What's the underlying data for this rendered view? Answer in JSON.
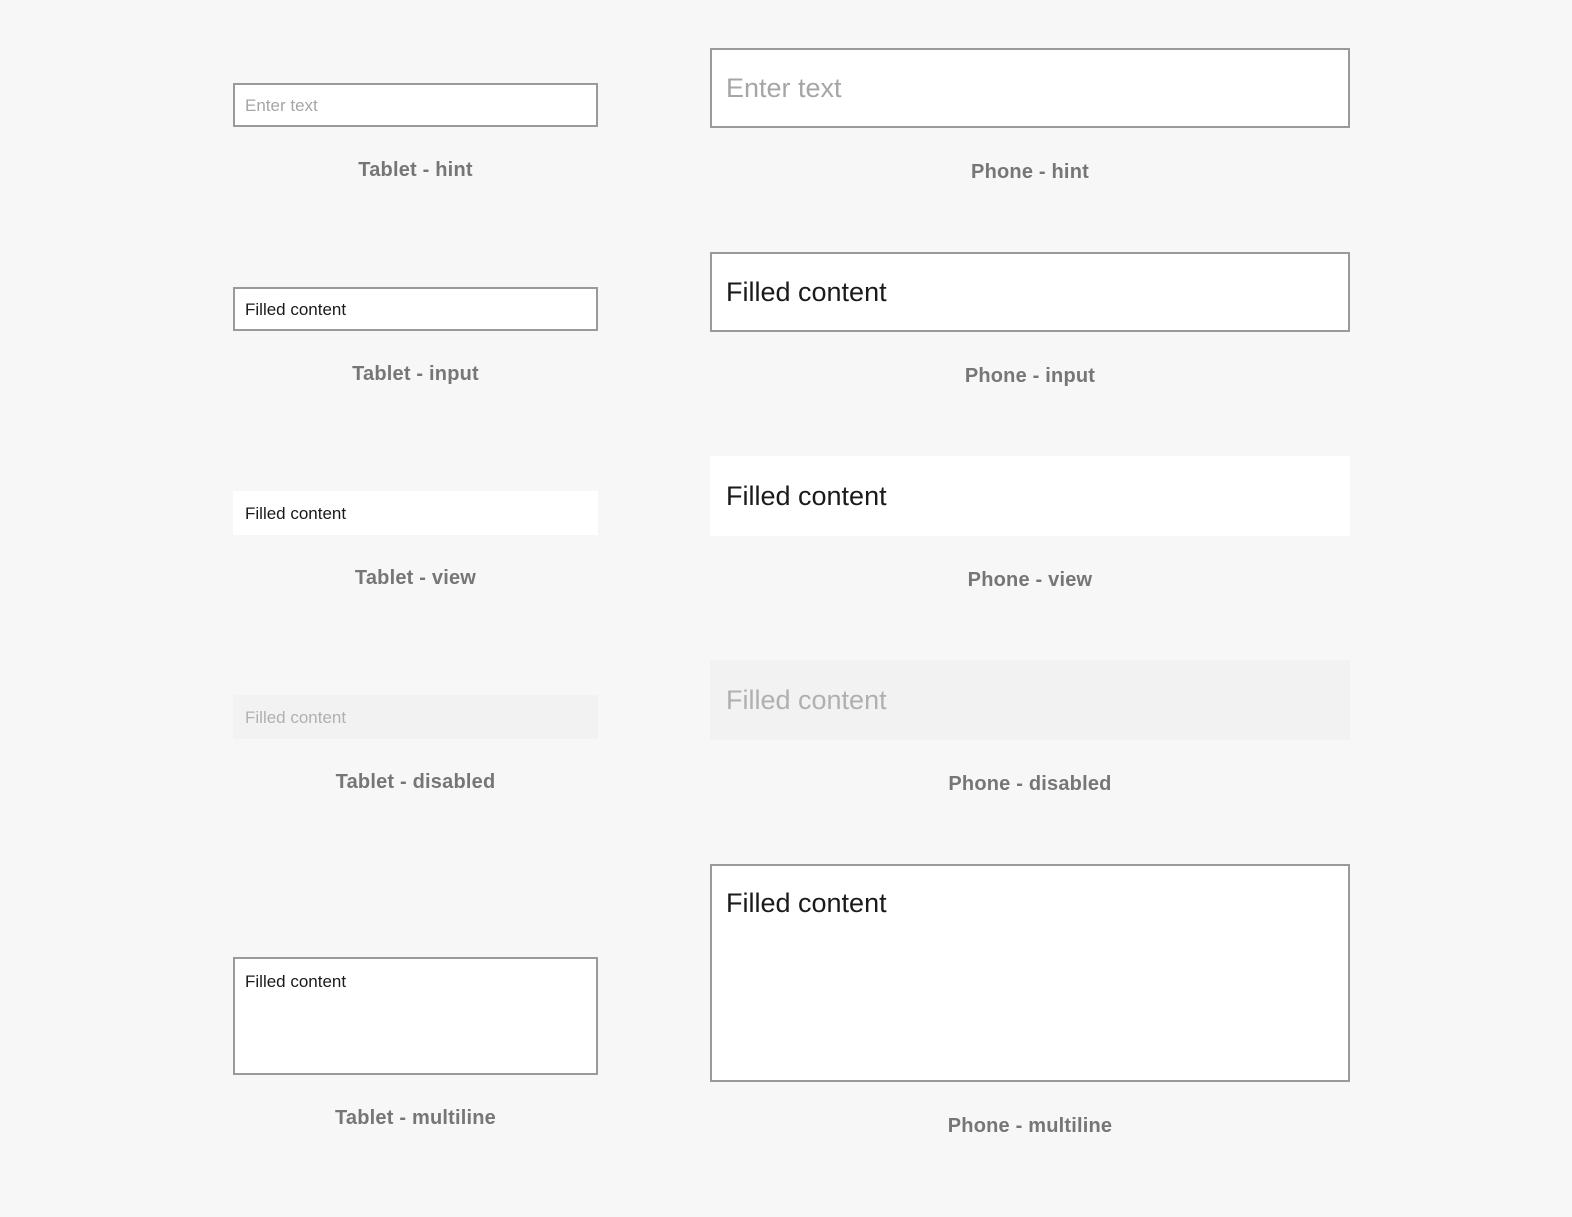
{
  "page": {
    "background_color": "#f7f7f7",
    "border_color": "#9a9a9a",
    "disabled_fill_color": "#f2f2f2",
    "field_fill_color": "#ffffff",
    "hint_text_color": "#a6a6a6",
    "filled_text_color": "#1a1a1a",
    "disabled_text_color": "#b0b0b0",
    "caption_text_color": "#767676"
  },
  "specimens": {
    "tablet_hint": {
      "value": "Enter text",
      "caption": "Tablet - hint"
    },
    "phone_hint": {
      "value": "Enter text",
      "caption": "Phone - hint"
    },
    "tablet_input": {
      "value": "Filled content",
      "caption": "Tablet - input"
    },
    "phone_input": {
      "value": "Filled content",
      "caption": "Phone - input"
    },
    "tablet_view": {
      "value": "Filled content",
      "caption": "Tablet - view"
    },
    "phone_view": {
      "value": "Filled content",
      "caption": "Phone - view"
    },
    "tablet_disabled": {
      "value": "Filled content",
      "caption": "Tablet - disabled"
    },
    "phone_disabled": {
      "value": "Filled content",
      "caption": "Phone - disabled"
    },
    "tablet_multiline": {
      "value": "Filled content",
      "caption": "Tablet - multiline"
    },
    "phone_multiline": {
      "value": "Filled content",
      "caption": "Phone - multiline"
    }
  }
}
